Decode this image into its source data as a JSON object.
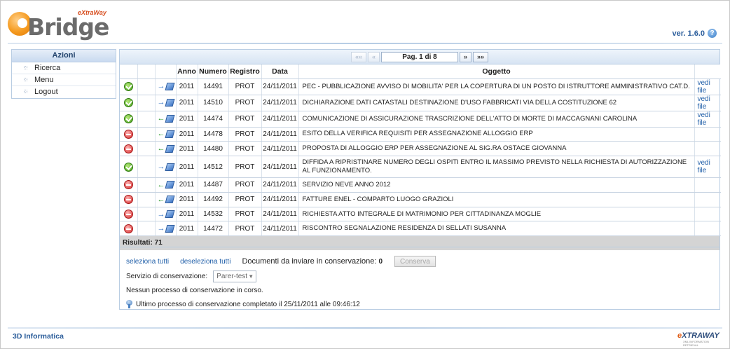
{
  "header": {
    "logo_text": "Bridge",
    "logo_tag": "eXtraWay",
    "version": "ver. 1.6.0"
  },
  "sidebar": {
    "title": "Azioni",
    "items": [
      {
        "label": "Ricerca"
      },
      {
        "label": "Menu"
      },
      {
        "label": "Logout"
      }
    ]
  },
  "pager": {
    "first": "««",
    "prev": "«",
    "info": "Pag. 1 di 8",
    "next": "»",
    "last": "»»"
  },
  "table": {
    "columns": [
      "",
      "",
      "",
      "Anno",
      "Numero",
      "Registro",
      "Data",
      "Oggetto",
      ""
    ],
    "rows": [
      {
        "status": "ok",
        "dir": "in",
        "anno": "2011",
        "numero": "14491",
        "registro": "PROT",
        "data": "24/11/2011",
        "oggetto": "PEC - PUBBLICAZIONE AVVISO DI MOBILITA' PER LA COPERTURA DI UN POSTO DI ISTRUTTORE AMMINISTRATIVO CAT.D.",
        "link": "vedi file"
      },
      {
        "status": "ok",
        "dir": "in",
        "anno": "2011",
        "numero": "14510",
        "registro": "PROT",
        "data": "24/11/2011",
        "oggetto": "DICHIARAZIONE DATI CATASTALI DESTINAZIONE D'USO FABBRICATI VIA DELLA COSTITUZIONE 62",
        "link": "vedi file"
      },
      {
        "status": "ok",
        "dir": "out",
        "anno": "2011",
        "numero": "14474",
        "registro": "PROT",
        "data": "24/11/2011",
        "oggetto": "COMUNICAZIONE DI ASSICURAZIONE TRASCRIZIONE DELL'ATTO DI MORTE DI MACCAGNANI CAROLINA",
        "link": "vedi file"
      },
      {
        "status": "no",
        "dir": "out",
        "anno": "2011",
        "numero": "14478",
        "registro": "PROT",
        "data": "24/11/2011",
        "oggetto": "ESITO DELLA VERIFICA REQUISITI PER ASSEGNAZIONE ALLOGGIO ERP",
        "link": ""
      },
      {
        "status": "no",
        "dir": "out",
        "anno": "2011",
        "numero": "14480",
        "registro": "PROT",
        "data": "24/11/2011",
        "oggetto": "PROPOSTA DI ALLOGGIO ERP PER ASSEGNAZIONE AL SIG.RA OSTACE GIOVANNA",
        "link": ""
      },
      {
        "status": "ok",
        "dir": "in",
        "anno": "2011",
        "numero": "14512",
        "registro": "PROT",
        "data": "24/11/2011",
        "oggetto": "DIFFIDA A RIPRISTINARE NUMERO DEGLI OSPITI ENTRO IL MASSIMO PREVISTO NELLA RICHIESTA DI AUTORIZZAZIONE AL FUNZIONAMENTO.",
        "link": "vedi file"
      },
      {
        "status": "no",
        "dir": "out",
        "anno": "2011",
        "numero": "14487",
        "registro": "PROT",
        "data": "24/11/2011",
        "oggetto": "SERVIZIO NEVE ANNO 2012",
        "link": ""
      },
      {
        "status": "no",
        "dir": "out",
        "anno": "2011",
        "numero": "14492",
        "registro": "PROT",
        "data": "24/11/2011",
        "oggetto": "FATTURE ENEL - COMPARTO LUOGO GRAZIOLI",
        "link": ""
      },
      {
        "status": "no",
        "dir": "in",
        "anno": "2011",
        "numero": "14532",
        "registro": "PROT",
        "data": "24/11/2011",
        "oggetto": "RICHIESTA ATTO INTEGRALE DI MATRIMONIO PER CITTADINANZA MOGLIE",
        "link": ""
      },
      {
        "status": "no",
        "dir": "in",
        "anno": "2011",
        "numero": "14472",
        "registro": "PROT",
        "data": "24/11/2011",
        "oggetto": "RISCONTRO SEGNALAZIONE RESIDENZA DI SELLATI SUSANNA",
        "link": ""
      }
    ]
  },
  "results": "Risultati: 71",
  "conservazione": {
    "select_all": "seleziona tutti",
    "deselect_all": "deseleziona tutti",
    "docs_label": "Documenti da inviare in conservazione:",
    "docs_count": "0",
    "button": "Conserva",
    "service_label": "Servizio di conservazione:",
    "service_value": "Parer-test",
    "status_text": "Nessun processo di conservazione in corso.",
    "last_text": "Ultimo processo di conservazione completato il 25/11/2011 alle 09:46:12"
  },
  "footer": {
    "company": "3D Informatica",
    "brand": "eXTRAWAY",
    "brand_sub": "XML INFORMATION RETRIEVAL"
  }
}
